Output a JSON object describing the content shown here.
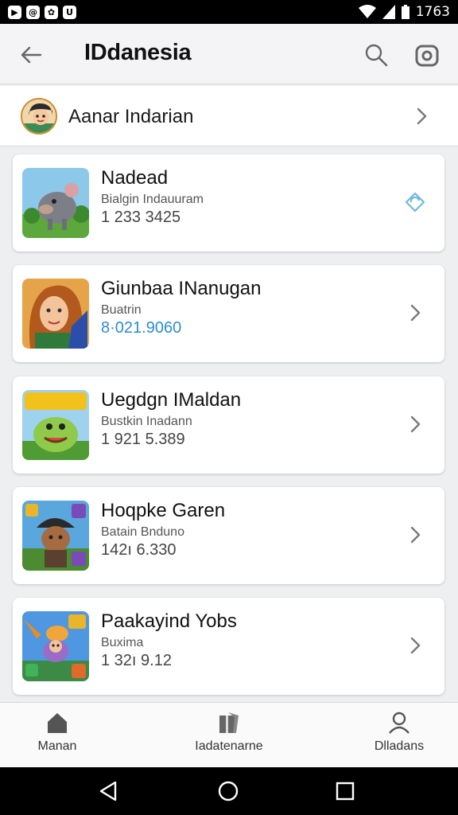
{
  "status_bar": {
    "app_icons": [
      "▶",
      "@",
      "✿",
      "U"
    ],
    "time": "1763"
  },
  "app_bar": {
    "title": "IDdanesia",
    "back_icon": "arrow-left-icon",
    "search_icon": "search-icon",
    "camera_icon": "camera-icon"
  },
  "profile": {
    "name": "Aanar Indarian"
  },
  "list": [
    {
      "name": "Nadead",
      "subtitle": "Bialgin Indauuram",
      "value": "1 233 3425",
      "value_style": "normal",
      "trail_icon": "refresh-icon"
    },
    {
      "name": "Giunbaa INanugan",
      "subtitle": "Buatrin",
      "value": "8·021.9060",
      "value_style": "blue",
      "trail_icon": "chevron-right-icon"
    },
    {
      "name": "Uegdgn IMaldan",
      "subtitle": "Bustkin Inadann",
      "value": "1 921 5.389",
      "value_style": "normal",
      "trail_icon": "chevron-right-icon"
    },
    {
      "name": "Hoqpke Garen",
      "subtitle": "Batain Bnduno",
      "value": "142ı 6.330",
      "value_style": "normal",
      "trail_icon": "chevron-right-icon"
    },
    {
      "name": "Paakayind Yobs",
      "subtitle": "Buxima",
      "value": "1 32ı 9.12",
      "value_style": "normal",
      "trail_icon": "chevron-right-icon"
    }
  ],
  "bottom_nav": [
    {
      "label": "Manan",
      "icon": "home-icon"
    },
    {
      "label": "Iadatenarne",
      "icon": "gift-icon"
    },
    {
      "label": "Dlladans",
      "icon": "person-icon"
    }
  ],
  "colors": {
    "background": "#eeeff1",
    "accent_blue": "#2d8bd3",
    "chevron": "#7a7a7a"
  }
}
